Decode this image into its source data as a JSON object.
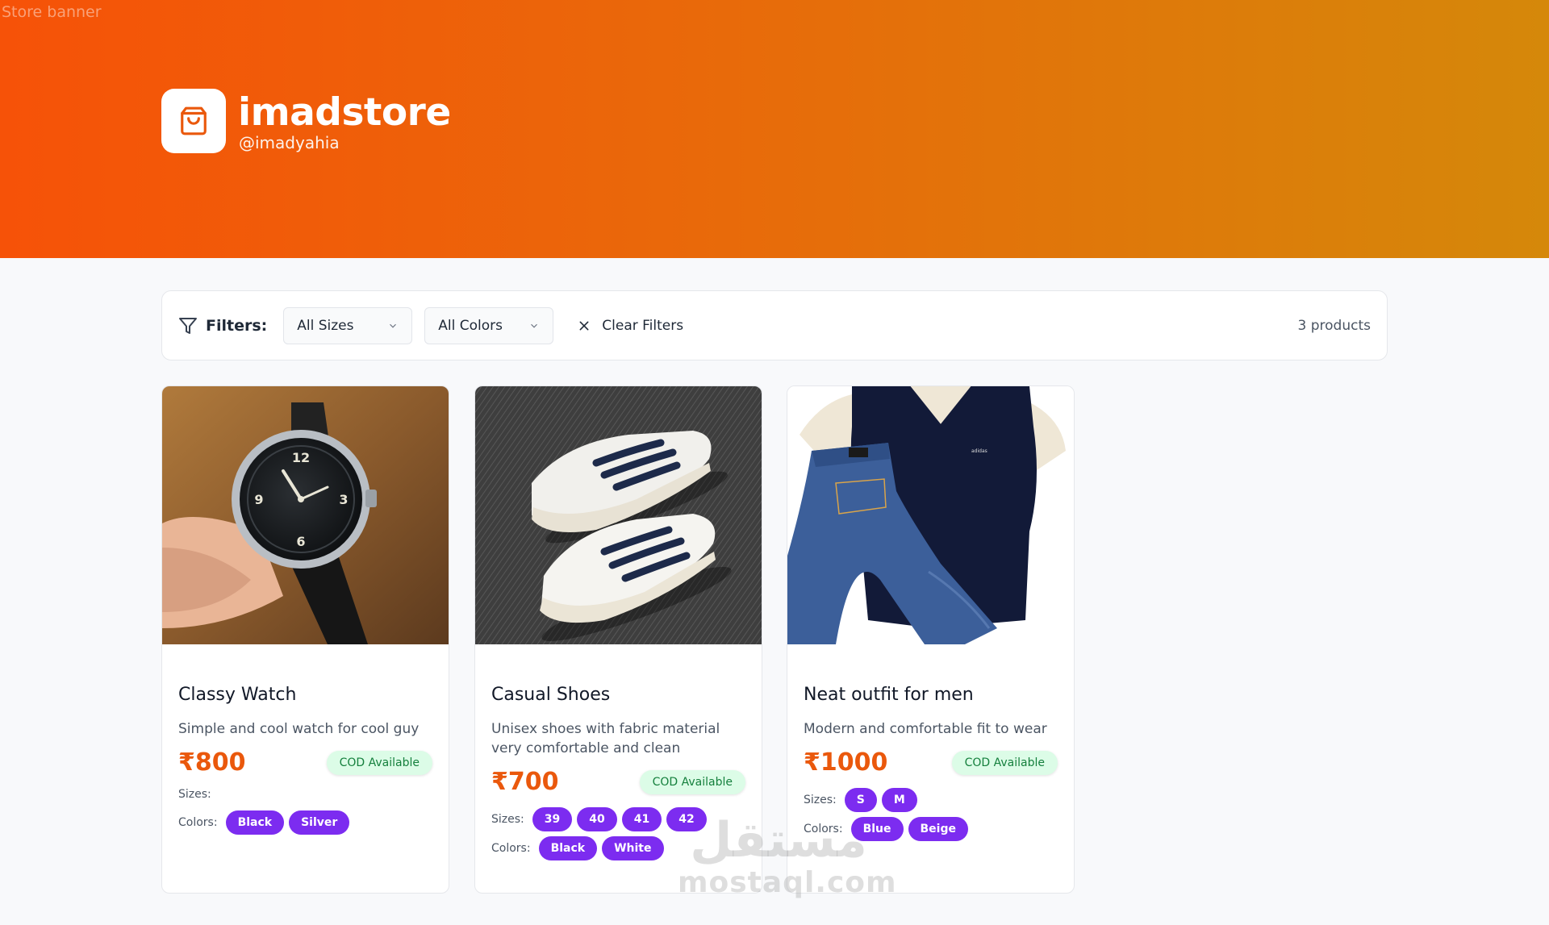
{
  "banner": {
    "alt": "Store banner"
  },
  "store": {
    "name": "imadstore",
    "handle": "@imadyahia"
  },
  "filters": {
    "label": "Filters:",
    "size_select": "All Sizes",
    "color_select": "All Colors",
    "clear_label": "Clear Filters",
    "count": "3 products"
  },
  "products": [
    {
      "title": "Classy Watch",
      "description": "Simple and cool watch for cool guy",
      "price": "₹800",
      "badge": "COD Available",
      "sizes_label": "Sizes:",
      "sizes": [],
      "colors_label": "Colors:",
      "colors": [
        "Black",
        "Silver"
      ]
    },
    {
      "title": "Casual Shoes",
      "description": "Unisex shoes with fabric material very comfortable and clean",
      "price": "₹700",
      "badge": "COD Available",
      "sizes_label": "Sizes:",
      "sizes": [
        "39",
        "40",
        "41",
        "42"
      ],
      "colors_label": "Colors:",
      "colors": [
        "Black",
        "White"
      ]
    },
    {
      "title": "Neat outfit for men",
      "description": "Modern and comfortable fit to wear",
      "price": "₹1000",
      "badge": "COD Available",
      "sizes_label": "Sizes:",
      "sizes": [
        "S",
        "M"
      ],
      "colors_label": "Colors:",
      "colors": [
        "Blue",
        "Beige"
      ]
    }
  ],
  "watermark": {
    "arabic": "مستقل",
    "latin": "mostaql.com"
  },
  "colors": {
    "accent": "#f65208",
    "price": "#ea580c",
    "chip": "#7c2cf0",
    "cod_bg": "#dcfce7",
    "cod_text": "#15803d"
  },
  "icons": [
    "shopping-bag-icon",
    "filter-icon",
    "chevron-down-icon",
    "close-icon"
  ]
}
